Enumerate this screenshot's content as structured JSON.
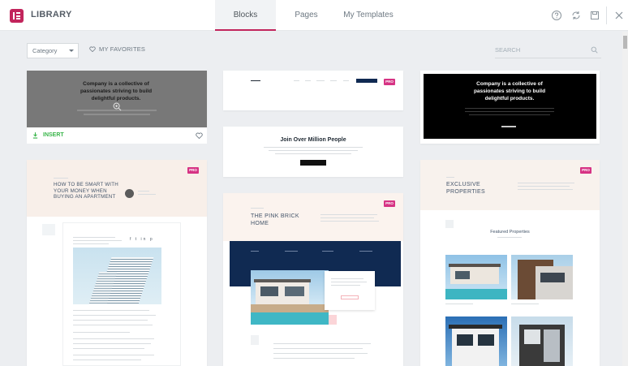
{
  "header": {
    "brand": "LIBRARY",
    "tabs": [
      {
        "label": "Blocks",
        "active": true
      },
      {
        "label": "Pages",
        "active": false
      },
      {
        "label": "My Templates",
        "active": false
      }
    ],
    "icons": [
      "help-icon",
      "sync-icon",
      "save-icon",
      "close-icon"
    ]
  },
  "toolbar": {
    "category_label": "Category",
    "favorites_label": "MY FAVORITES",
    "search_placeholder": "SEARCH"
  },
  "badges": {
    "pro": "PRO"
  },
  "cards": {
    "hero_gray": {
      "headline": "Company is a collective of passionates striving to build delightful products."
    },
    "insert_bar": {
      "insert_label": "INSERT"
    },
    "join": {
      "headline": "Join Over Million People"
    },
    "hero_black": {
      "headline": "Company is a collective of passionates striving to build delightful products."
    },
    "smart_money": {
      "headline": "HOW TO BE SMART WITH YOUR MONEY WHEN BUYING AN APARTMENT"
    },
    "pink_brick": {
      "headline": "THE PINK BRICK HOME"
    },
    "exclusive": {
      "headline": "EXCLUSIVE PROPERTIES",
      "subheading": "Featured Properties"
    }
  },
  "colors": {
    "accent": "#c2255c",
    "pro": "#d63384",
    "insert": "#39b54a",
    "navy": "#102a52"
  }
}
